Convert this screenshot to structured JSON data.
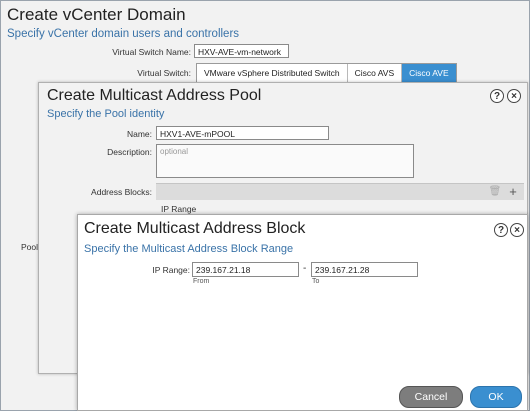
{
  "domain_dialog": {
    "title": "Create vCenter Domain",
    "subtitle": "Specify vCenter domain users and controllers",
    "vswitch_name_label": "Virtual Switch Name:",
    "vswitch_name_value": "HXV-AVE-vm-network",
    "vswitch_label": "Virtual Switch:",
    "vswitch_options": [
      "VMware vSphere Distributed Switch",
      "Cisco AVS",
      "Cisco AVE"
    ],
    "vswitch_selected": "Cisco AVE",
    "pool_label": "Pool"
  },
  "pool_dialog": {
    "title": "Create Multicast Address Pool",
    "subtitle": "Specify the Pool identity",
    "name_label": "Name:",
    "name_value": "HXV1-AVE-mPOOL",
    "description_label": "Description:",
    "description_placeholder": "optional",
    "address_blocks_label": "Address Blocks:",
    "ip_range_column": "IP Range",
    "help_icon": "?",
    "close_icon": "×"
  },
  "block_dialog": {
    "title": "Create Multicast Address Block",
    "subtitle": "Specify the Multicast Address Block Range",
    "ip_range_label": "IP Range:",
    "from_value": "239.167.21.18",
    "from_hint": "From",
    "to_value": "239.167.21.28",
    "to_hint": "To",
    "dash": "-",
    "cancel_label": "Cancel",
    "ok_label": "OK",
    "help_icon": "?",
    "close_icon": "×"
  },
  "colors": {
    "accent": "#3a8fd0",
    "subtitle": "#3a73a8",
    "cancel": "#7d7d7d"
  }
}
